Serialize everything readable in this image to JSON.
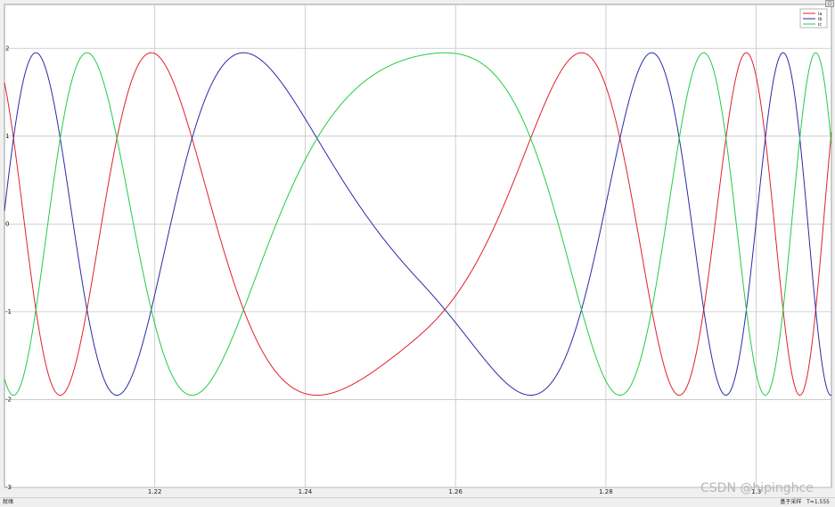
{
  "status": {
    "left": "就绪",
    "sampling": "基于采样",
    "time": "T=1.555"
  },
  "watermark": "CSDN @hipinghce",
  "colors": {
    "ia": "#e0202a",
    "ib": "#2a2aa8",
    "ic": "#22cc44",
    "grid": "#c4c4c4",
    "plot_bg": "#ffffff"
  },
  "chart_data": {
    "type": "line",
    "title": "",
    "xlabel": "",
    "ylabel": "",
    "xlim": [
      1.2,
      1.31
    ],
    "ylim": [
      -3,
      2.5
    ],
    "xticks": [
      1.22,
      1.24,
      1.26,
      1.28,
      1.3
    ],
    "xtick_labels": [
      "1.22",
      "1.24",
      "1.26",
      "1.28",
      "1.3"
    ],
    "yticks": [
      -3,
      -2,
      -1,
      0,
      1,
      2
    ],
    "ytick_labels": [
      "-3",
      "-2",
      "-1",
      "0",
      "1",
      "2"
    ],
    "grid": true,
    "legend_position": "top-right",
    "signal_model": {
      "amplitude": 1.95,
      "carrier_hz_start": 60,
      "carrier_hz_min": 8,
      "carrier_hz_end": 85,
      "slow_freq_time": 1.255,
      "phase_shift_deg": 120
    },
    "series": [
      {
        "name": "ia",
        "phase_offset_deg": 0
      },
      {
        "name": "ib",
        "phase_offset_deg": -120
      },
      {
        "name": "ic",
        "phase_offset_deg": 120
      }
    ]
  }
}
